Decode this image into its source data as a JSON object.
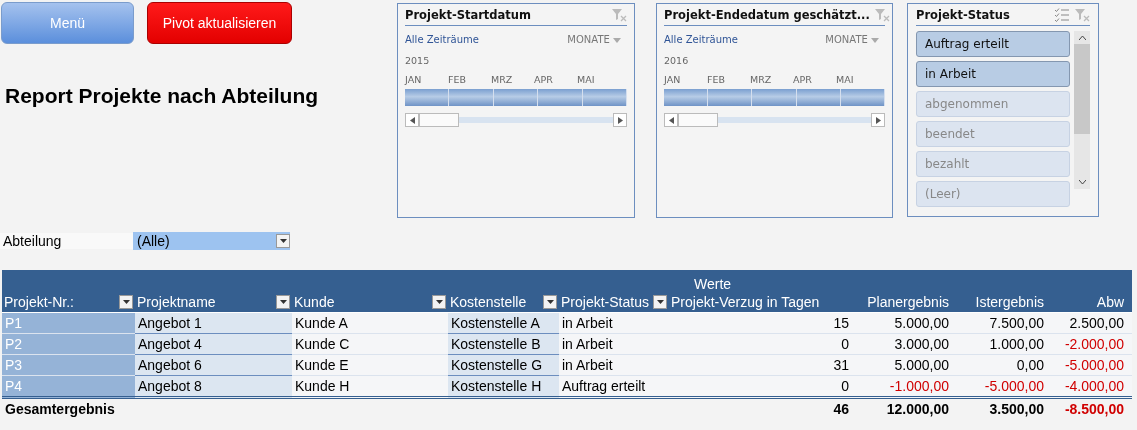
{
  "buttons": [
    {
      "label": "Menü",
      "kind": "menu"
    },
    {
      "label": "Pivot aktualisieren",
      "kind": "refresh"
    }
  ],
  "report_title": "Report Projekte nach Abteilung",
  "timelines": [
    {
      "title": "Projekt-Startdatum",
      "range_link": "Alle Zeiträume",
      "unit": "MONATE",
      "year": "2015",
      "months": [
        "JAN",
        "FEB",
        "MRZ",
        "APR",
        "MAI"
      ]
    },
    {
      "title": "Projekt-Endedatum geschätzt...",
      "range_link": "Alle Zeiträume",
      "unit": "MONATE",
      "year": "2016",
      "months": [
        "JAN",
        "FEB",
        "MRZ",
        "APR",
        "MAI"
      ]
    }
  ],
  "status_slicer": {
    "title": "Projekt-Status",
    "items": [
      {
        "label": "Auftrag erteilt",
        "selected": true
      },
      {
        "label": "in Arbeit",
        "selected": true
      },
      {
        "label": "abgenommen",
        "selected": false
      },
      {
        "label": "beendet",
        "selected": false
      },
      {
        "label": "bezahlt",
        "selected": false
      },
      {
        "label": "(Leer)",
        "selected": false
      }
    ]
  },
  "filter": {
    "label": "Abteilung",
    "value": "(Alle)"
  },
  "pivot": {
    "values_caption": "Werte",
    "columns": [
      {
        "label": "Projekt-Nr.:",
        "dropdown": true
      },
      {
        "label": "Projektname",
        "dropdown": true
      },
      {
        "label": "Kunde",
        "dropdown": true
      },
      {
        "label": "Kostenstelle",
        "dropdown": true
      },
      {
        "label": "Projekt-Status",
        "dropdown": true
      },
      {
        "label": "Projekt-Verzug in Tagen",
        "dropdown": false
      },
      {
        "label": "Planergebnis",
        "dropdown": false
      },
      {
        "label": "Istergebnis",
        "dropdown": false
      },
      {
        "label": "Abw",
        "dropdown": false
      }
    ],
    "rows": [
      {
        "cells": [
          {
            "text": "P1"
          },
          {
            "text": "Angebot 1"
          },
          {
            "text": "Kunde A"
          },
          {
            "text": "Kostenstelle A"
          },
          {
            "text": "in Arbeit"
          },
          {
            "text": "15"
          },
          {
            "text": "5.000,00"
          },
          {
            "text": "7.500,00"
          },
          {
            "text": "2.500,00"
          }
        ]
      },
      {
        "cells": [
          {
            "text": "P2"
          },
          {
            "text": "Angebot 4"
          },
          {
            "text": "Kunde C"
          },
          {
            "text": "Kostenstelle B"
          },
          {
            "text": "in Arbeit"
          },
          {
            "text": "0"
          },
          {
            "text": "3.000,00"
          },
          {
            "text": "1.000,00"
          },
          {
            "text": "-2.000,00",
            "negative": true
          }
        ]
      },
      {
        "cells": [
          {
            "text": "P3"
          },
          {
            "text": "Angebot 6"
          },
          {
            "text": "Kunde E"
          },
          {
            "text": "Kostenstelle G"
          },
          {
            "text": "in Arbeit"
          },
          {
            "text": "31"
          },
          {
            "text": "5.000,00"
          },
          {
            "text": "0,00"
          },
          {
            "text": "-5.000,00",
            "negative": true
          }
        ]
      },
      {
        "cells": [
          {
            "text": "P4"
          },
          {
            "text": "Angebot 8"
          },
          {
            "text": "Kunde H"
          },
          {
            "text": "Kostenstelle H"
          },
          {
            "text": "Auftrag erteilt"
          },
          {
            "text": "0"
          },
          {
            "text": "-1.000,00",
            "negative": true
          },
          {
            "text": "-5.000,00",
            "negative": true
          },
          {
            "text": "-4.000,00",
            "negative": true
          }
        ]
      }
    ],
    "total": {
      "label": "Gesamtergebnis",
      "cells": [
        {
          "text": "46"
        },
        {
          "text": "12.000,00"
        },
        {
          "text": "3.500,00"
        },
        {
          "text": "-8.500,00",
          "negative": true
        }
      ]
    }
  }
}
